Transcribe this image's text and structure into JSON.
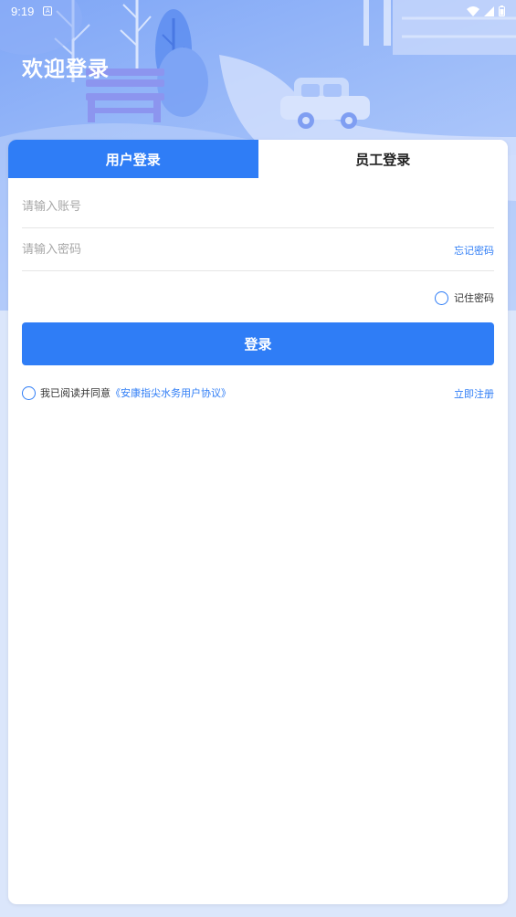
{
  "status_bar": {
    "time": "9:19",
    "notification_glyph": "A",
    "icons": [
      "wifi-icon",
      "signal-icon",
      "battery-icon"
    ]
  },
  "header": {
    "title": "欢迎登录"
  },
  "tabs": [
    {
      "label": "用户登录",
      "active": true
    },
    {
      "label": "员工登录",
      "active": false
    }
  ],
  "form": {
    "account_placeholder": "请输入账号",
    "password_placeholder": "请输入密码",
    "forgot_label": "忘记密码",
    "remember_label": "记住密码",
    "submit_label": "登录"
  },
  "agreement": {
    "prefix": "我已阅读并同意",
    "link_label": "《安康指尖水务用户协议》",
    "register_label": "立即注册"
  },
  "colors": {
    "accent": "#2f7df6",
    "hero_top": "#7fa6f6",
    "hero_bottom": "#c2d5fb",
    "page_background": "#dbe6fb"
  }
}
